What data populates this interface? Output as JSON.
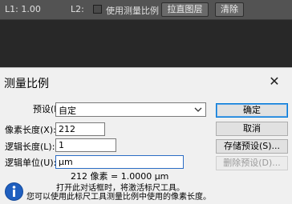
{
  "ps_options_bar": {
    "l1": "L1: 1.00",
    "l2": "L2:",
    "use_measure_scale_label": "使用测量比例",
    "straighten_layer_button": "拉直图层",
    "clear_button": "清除"
  },
  "dialog": {
    "title": "测量比例",
    "close_symbol": "✕",
    "preset": {
      "label": "预设(P):",
      "value": "自定"
    },
    "pixel_length": {
      "label": "像素长度(X):",
      "value": "212"
    },
    "logical_length": {
      "label": "逻辑长度(L):",
      "value": "1"
    },
    "logical_unit": {
      "label": "逻辑单位(U):",
      "value": "μm"
    },
    "result": "212 像素 = 1.0000 μm",
    "info_line1": "打开此对话框时，将激活标尺工具。",
    "info_line2": "您可以使用此标尺工具测量比例中使用的像素长度。",
    "buttons": {
      "ok": "确定",
      "cancel": "取消",
      "save_preset": "存储预设(S)...",
      "delete_preset": "删除预设(D)..."
    }
  },
  "colors": {
    "ps_bar": "#535353",
    "ps_canvas": "#282828",
    "dialog_bg": "#f0f0f0",
    "focus_blue": "#0078d7",
    "info_icon_blue": "#1f5fbf"
  },
  "icons": {
    "dropdown": "chevron-down-icon",
    "info": "info-icon",
    "close": "close-icon"
  }
}
